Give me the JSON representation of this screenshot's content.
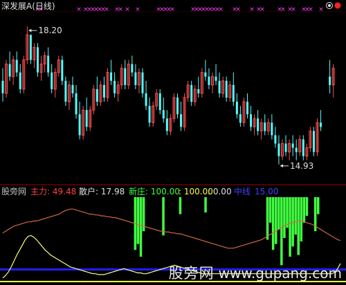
{
  "chart_data": [
    {
      "type": "candlestick",
      "title": "深发展A(日线)",
      "annotations": {
        "high_label": "18.20",
        "low_label": "14.93"
      },
      "ylim": [
        14.5,
        18.5
      ],
      "candles": [
        [
          16.9,
          17.2,
          16.4,
          16.6
        ],
        [
          16.6,
          17.4,
          16.5,
          17.3
        ],
        [
          17.3,
          17.6,
          16.9,
          17.0
        ],
        [
          17.0,
          17.5,
          16.8,
          17.4
        ],
        [
          17.4,
          17.6,
          17.0,
          17.1
        ],
        [
          17.1,
          17.3,
          16.6,
          16.7
        ],
        [
          16.7,
          17.5,
          16.6,
          17.4
        ],
        [
          17.4,
          18.2,
          17.3,
          18.0
        ],
        [
          18.0,
          18.0,
          17.3,
          17.4
        ],
        [
          17.4,
          17.8,
          17.2,
          17.7
        ],
        [
          17.7,
          17.8,
          17.0,
          17.1
        ],
        [
          17.1,
          17.5,
          16.9,
          17.3
        ],
        [
          17.3,
          17.6,
          17.1,
          17.5
        ],
        [
          17.5,
          17.7,
          17.0,
          17.1
        ],
        [
          17.1,
          17.3,
          16.6,
          16.7
        ],
        [
          16.7,
          17.2,
          16.5,
          17.1
        ],
        [
          17.1,
          17.5,
          17.0,
          17.4
        ],
        [
          17.4,
          17.5,
          16.8,
          16.9
        ],
        [
          16.9,
          17.0,
          16.3,
          16.4
        ],
        [
          16.4,
          16.9,
          16.2,
          16.8
        ],
        [
          16.8,
          17.0,
          16.5,
          16.6
        ],
        [
          16.6,
          16.8,
          16.0,
          16.1
        ],
        [
          16.1,
          16.4,
          15.5,
          15.6
        ],
        [
          15.6,
          16.3,
          15.5,
          16.2
        ],
        [
          16.2,
          16.5,
          15.7,
          15.8
        ],
        [
          15.8,
          16.3,
          15.7,
          16.2
        ],
        [
          16.2,
          16.8,
          16.1,
          16.7
        ],
        [
          16.7,
          17.0,
          16.3,
          16.4
        ],
        [
          16.4,
          16.9,
          16.3,
          16.8
        ],
        [
          16.8,
          17.0,
          16.4,
          16.5
        ],
        [
          16.5,
          17.2,
          16.4,
          17.1
        ],
        [
          17.1,
          17.4,
          16.8,
          16.9
        ],
        [
          16.9,
          17.1,
          16.5,
          16.6
        ],
        [
          16.6,
          16.9,
          16.4,
          16.8
        ],
        [
          16.8,
          17.3,
          16.7,
          17.2
        ],
        [
          17.2,
          17.4,
          16.7,
          16.8
        ],
        [
          16.8,
          17.4,
          16.7,
          17.3
        ],
        [
          17.3,
          17.5,
          17.0,
          17.1
        ],
        [
          17.1,
          17.3,
          16.7,
          16.8
        ],
        [
          16.8,
          17.2,
          16.6,
          17.1
        ],
        [
          17.1,
          17.2,
          16.5,
          16.6
        ],
        [
          16.6,
          16.9,
          16.2,
          16.3
        ],
        [
          16.3,
          16.5,
          15.8,
          15.9
        ],
        [
          15.9,
          16.4,
          15.8,
          16.3
        ],
        [
          16.3,
          16.7,
          16.2,
          16.6
        ],
        [
          16.6,
          16.7,
          16.1,
          16.2
        ],
        [
          16.2,
          16.5,
          15.9,
          16.0
        ],
        [
          16.0,
          16.2,
          15.6,
          15.7
        ],
        [
          15.7,
          16.1,
          15.6,
          16.0
        ],
        [
          16.0,
          16.6,
          15.9,
          16.5
        ],
        [
          16.5,
          16.6,
          16.0,
          16.1
        ],
        [
          16.1,
          16.4,
          15.7,
          15.8
        ],
        [
          15.8,
          16.6,
          15.7,
          16.5
        ],
        [
          16.5,
          16.9,
          16.4,
          16.8
        ],
        [
          16.8,
          16.9,
          16.3,
          16.4
        ],
        [
          16.4,
          16.8,
          16.3,
          16.7
        ],
        [
          16.7,
          17.0,
          16.5,
          16.6
        ],
        [
          16.6,
          17.2,
          16.5,
          17.1
        ],
        [
          17.1,
          17.4,
          16.9,
          17.0
        ],
        [
          17.0,
          17.2,
          16.7,
          16.8
        ],
        [
          16.8,
          17.1,
          16.6,
          17.0
        ],
        [
          17.0,
          17.3,
          16.8,
          16.9
        ],
        [
          16.9,
          17.1,
          16.5,
          16.6
        ],
        [
          16.6,
          17.0,
          16.5,
          16.9
        ],
        [
          16.9,
          17.0,
          16.4,
          16.5
        ],
        [
          16.5,
          16.9,
          16.4,
          16.8
        ],
        [
          16.8,
          17.1,
          16.3,
          16.4
        ],
        [
          16.4,
          16.6,
          16.0,
          16.1
        ],
        [
          16.1,
          16.3,
          15.8,
          15.9
        ],
        [
          15.9,
          16.5,
          15.8,
          16.4
        ],
        [
          16.4,
          16.6,
          16.0,
          16.1
        ],
        [
          16.1,
          16.3,
          15.7,
          15.8
        ],
        [
          15.8,
          16.1,
          15.6,
          16.0
        ],
        [
          16.0,
          16.2,
          15.6,
          15.7
        ],
        [
          15.7,
          16.0,
          15.5,
          15.9
        ],
        [
          15.9,
          16.1,
          15.6,
          15.7
        ],
        [
          15.7,
          16.0,
          15.6,
          15.9
        ],
        [
          15.9,
          16.1,
          15.5,
          15.6
        ],
        [
          15.6,
          15.8,
          15.3,
          15.4
        ],
        [
          15.4,
          15.6,
          14.9,
          15.1
        ],
        [
          15.1,
          15.5,
          15.0,
          15.4
        ],
        [
          15.4,
          15.6,
          15.1,
          15.2
        ],
        [
          15.2,
          15.5,
          15.0,
          15.4
        ],
        [
          15.4,
          15.6,
          15.1,
          15.3
        ],
        [
          15.3,
          15.5,
          15.0,
          15.2
        ],
        [
          15.2,
          15.6,
          15.1,
          15.5
        ],
        [
          15.5,
          15.6,
          15.0,
          15.1
        ],
        [
          15.1,
          15.4,
          15.0,
          15.3
        ],
        [
          15.3,
          15.8,
          15.2,
          15.7
        ],
        [
          15.7,
          15.8,
          15.1,
          15.2
        ],
        [
          15.2,
          16.0,
          15.1,
          15.9
        ],
        [
          15.9,
          16.2,
          15.7,
          15.8
        ],
        [
          17.0,
          17.4,
          16.6,
          16.8
        ],
        [
          16.8,
          17.3,
          16.5,
          17.2
        ]
      ],
      "gap_after_index": 91
    },
    {
      "type": "indicator",
      "legend": [
        {
          "label": "股旁网",
          "color": "#c0c0c0"
        },
        {
          "label": "主力: 49.48",
          "color": "#ff4040"
        },
        {
          "label": "散户: 17.98",
          "color": "#e0e0e0"
        },
        {
          "label": "新庄: 100.00",
          "color": "#40ff40"
        },
        {
          "label": ": 100.00",
          "color": "#ffff40"
        },
        {
          "label": ": 0.00",
          "color": "#e0e0e0"
        },
        {
          "label": "中线",
          "color": "#4040ff"
        },
        {
          "label": "15.00",
          "color": "#4040ff"
        }
      ],
      "ylim": [
        0,
        100
      ],
      "level_line": 15,
      "zhuli": [
        58,
        60,
        62,
        64,
        66,
        67,
        68,
        69,
        70,
        71,
        71,
        72,
        72,
        73,
        74,
        75,
        76,
        77,
        78,
        79,
        80,
        82,
        84,
        85,
        86,
        86,
        85,
        84,
        83,
        82,
        81,
        80,
        80,
        79,
        79,
        78,
        78,
        77,
        77,
        76,
        76,
        75,
        74,
        73,
        72,
        71,
        70,
        69,
        68,
        67,
        66,
        65,
        64,
        63,
        62,
        61,
        60,
        60,
        59,
        59,
        58,
        58,
        57,
        57,
        56,
        55,
        54,
        53,
        52,
        51,
        50,
        49,
        48,
        47,
        46,
        45,
        44,
        43,
        42,
        41,
        40,
        40,
        40,
        41,
        42,
        43,
        44,
        45,
        46,
        47,
        48,
        49,
        50,
        52,
        54,
        56,
        58,
        60,
        62,
        64,
        66,
        68,
        69,
        70,
        71,
        72,
        72,
        71,
        70,
        69,
        68,
        66,
        64,
        62,
        60,
        58,
        56,
        54,
        52,
        50,
        49
      ],
      "sanhu": [
        5,
        8,
        12,
        18,
        25,
        32,
        38,
        44,
        50,
        54,
        55,
        53,
        50,
        46,
        42,
        38,
        35,
        32,
        30,
        28,
        26,
        24,
        22,
        20,
        18,
        17,
        16,
        15,
        14,
        13,
        12,
        11,
        10,
        10,
        9,
        9,
        9,
        10,
        11,
        12,
        13,
        14,
        15,
        16,
        15,
        14,
        13,
        12,
        11,
        11,
        10,
        10,
        11,
        12,
        13,
        14,
        15,
        16,
        17,
        18,
        19,
        20,
        19,
        18,
        17,
        16,
        15,
        14,
        13,
        12,
        11,
        10,
        10,
        10,
        10,
        10,
        10,
        10,
        10,
        10,
        10,
        10,
        10,
        10,
        10,
        10,
        10,
        10,
        10,
        10,
        10,
        10,
        10,
        10,
        10,
        10,
        10,
        10,
        10,
        10,
        10,
        10,
        10,
        10,
        10,
        10,
        10,
        10,
        10,
        10,
        10,
        10,
        10,
        10,
        10,
        10,
        10,
        10,
        12,
        16,
        22
      ],
      "xinzhuang": [
        0,
        0,
        0,
        0,
        0,
        0,
        0,
        0,
        0,
        0,
        0,
        0,
        0,
        0,
        0,
        0,
        0,
        0,
        0,
        0,
        0,
        0,
        0,
        0,
        0,
        0,
        0,
        0,
        0,
        0,
        0,
        0,
        0,
        0,
        0,
        0,
        0,
        0,
        0,
        0,
        0,
        0,
        0,
        0,
        0,
        0,
        0,
        0,
        0,
        0,
        0,
        0,
        0,
        0,
        0,
        0,
        0,
        0,
        0,
        0,
        0,
        0,
        0,
        0,
        0,
        0,
        0,
        0,
        0,
        0,
        0,
        0,
        0,
        0,
        0,
        0,
        0,
        0,
        0,
        0,
        0,
        0,
        0,
        0,
        0,
        0,
        0,
        0,
        0,
        0,
        0,
        0,
        0,
        0,
        0,
        0,
        0,
        0,
        0,
        0,
        0,
        0,
        0,
        0,
        0,
        0,
        0,
        0,
        0,
        0,
        0,
        0,
        0,
        0,
        0,
        0,
        0,
        0,
        0,
        0,
        0,
        0,
        0,
        0,
        0,
        0,
        0,
        0,
        0,
        0,
        0,
        0
      ]
    }
  ],
  "watermark": {
    "cn": "股旁网",
    "en": "www.gupang.com"
  }
}
